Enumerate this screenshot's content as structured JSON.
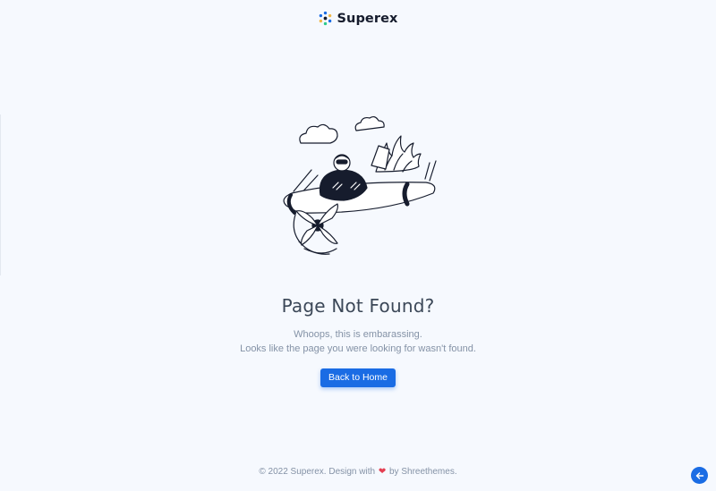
{
  "brand": {
    "name": "Superex",
    "logo_icon": "superex-logo-icon"
  },
  "error": {
    "title": "Page Not Found?",
    "message_line1": "Whoops, this is embarassing.",
    "message_line2": "Looks like the page you were looking for wasn't found.",
    "button_label": "Back to Home",
    "illustration": "pilot-airplane-illustration"
  },
  "footer": {
    "prefix": "© 2022 Superex. Design with",
    "heart_icon": "heart-icon",
    "suffix": "by Shreethemes."
  },
  "scroll_top": {
    "icon": "arrow-left-icon"
  },
  "colors": {
    "accent": "#1a6ce4",
    "background": "#f6f9fe",
    "heading": "#3c4858",
    "muted": "#8492a6",
    "heart": "#e43f52"
  }
}
